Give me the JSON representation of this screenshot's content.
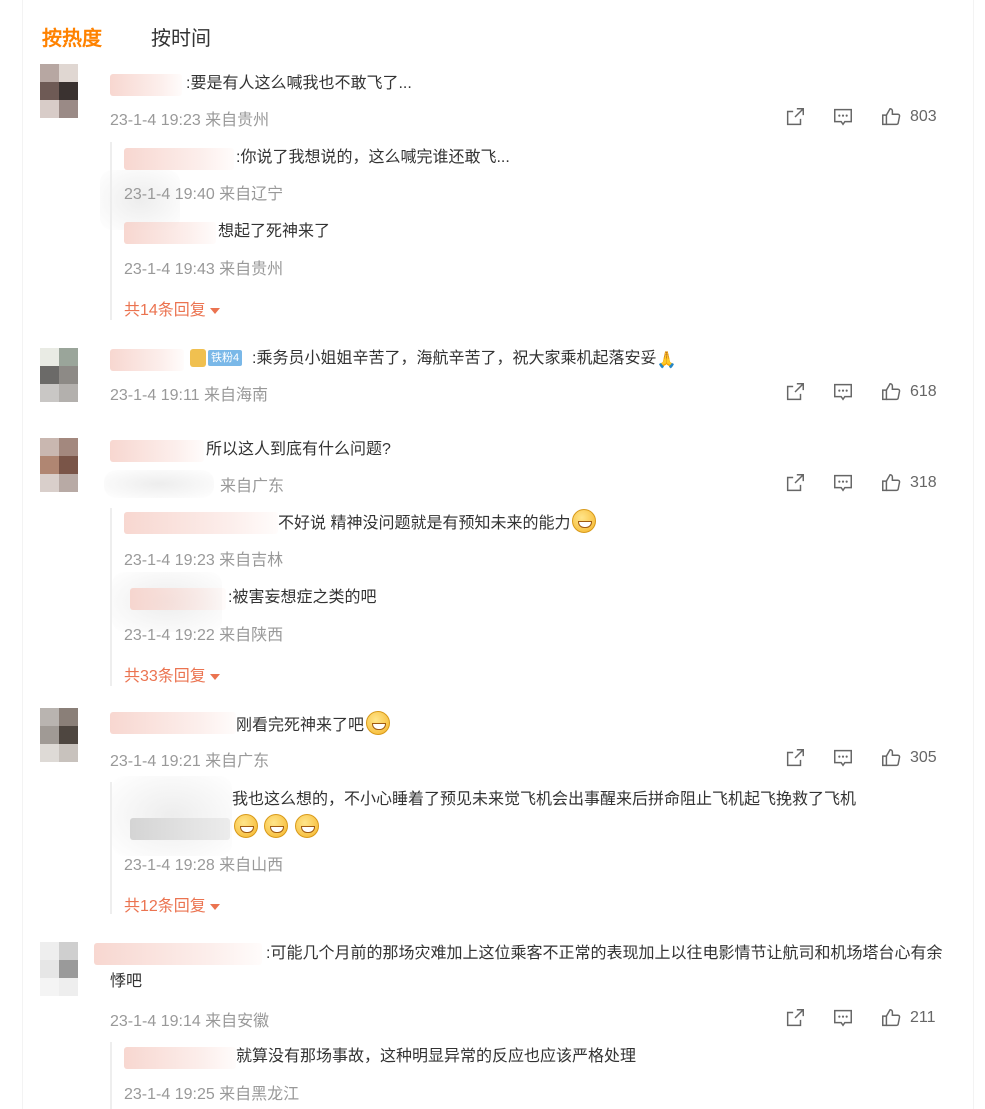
{
  "tabs": {
    "hot": "按热度",
    "time": "按时间"
  },
  "comments": [
    {
      "text": ":要是有人这么喊我也不敢飞了...",
      "meta": "23-1-4 19:23 来自贵州",
      "likes": "803",
      "replies": [
        {
          "text": ":你说了我想说的，这么喊完谁还敢飞...",
          "meta": "23-1-4 19:40 来自辽宁"
        },
        {
          "text": "想起了死神来了",
          "meta": "23-1-4 19:43 来自贵州"
        }
      ],
      "more": "共14条回复"
    },
    {
      "badge": "铁粉4",
      "text": ":乘务员小姐姐辛苦了，海航辛苦了，祝大家乘机起落安妥",
      "meta": "23-1-4 19:11 来自海南",
      "likes": "618"
    },
    {
      "text": "所以这人到底有什么问题?",
      "meta": "来自广东",
      "likes": "318",
      "replies": [
        {
          "text": "不好说 精神没问题就是有预知未来的能力",
          "meta": "23-1-4 19:23 来自吉林"
        },
        {
          "text": ":被害妄想症之类的吧",
          "meta": "23-1-4 19:22 来自陕西"
        }
      ],
      "more": "共33条回复"
    },
    {
      "text": "刚看完死神来了吧",
      "meta": "23-1-4 19:21 来自广东",
      "likes": "305",
      "replies": [
        {
          "text": "我也这么想的，不小心睡着了预见未来觉飞机会出事醒来后拼命阻止飞机起飞挽救了飞机",
          "meta": "23-1-4 19:28 来自山西"
        }
      ],
      "more": "共12条回复"
    },
    {
      "text": ":可能几个月前的那场灾难加上这位乘客不正常的表现加上以往电影情节让航司和机场塔台心有余悸吧",
      "meta": "23-1-4 19:14 来自安徽",
      "likes": "211",
      "replies": [
        {
          "text": "就算没有那场事故，这种明显异常的反应也应该严格处理",
          "meta": "23-1-4 19:25 来自黑龙江"
        }
      ]
    }
  ],
  "icons": {
    "share": "share-icon",
    "comment": "comment-icon",
    "like": "like-icon"
  },
  "colors": {
    "accent": "#ff8200",
    "more": "#eb7350",
    "meta": "#999999",
    "badge": "#7ab8e8"
  }
}
